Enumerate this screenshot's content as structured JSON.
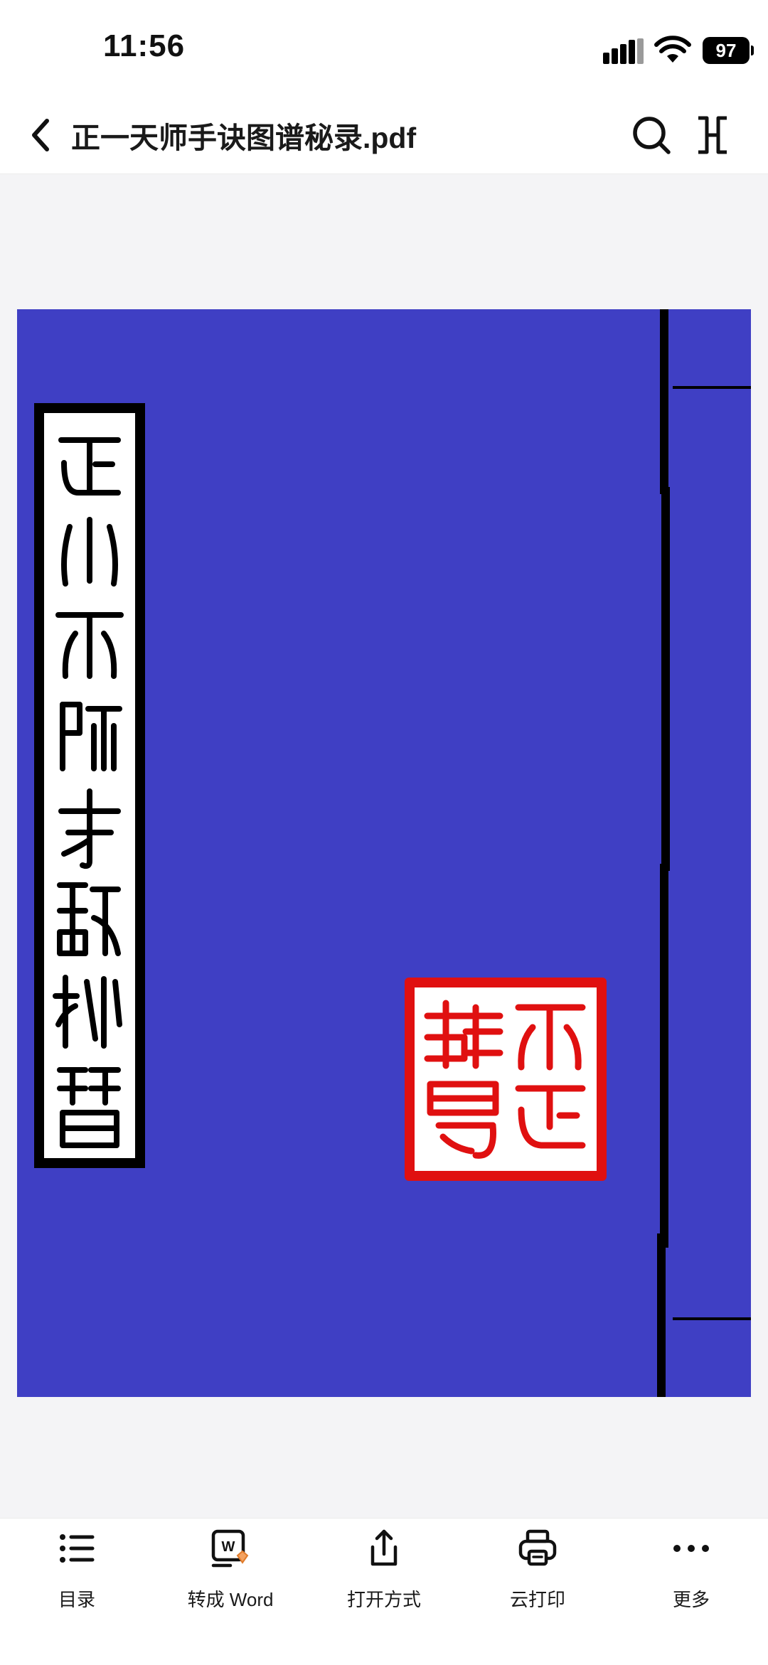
{
  "status_bar": {
    "time": "11:56",
    "battery": "97"
  },
  "header": {
    "title": "正一天师手诀图谱秘录.pdf"
  },
  "icons": {
    "back": "chevron-left-icon",
    "search": "search-icon",
    "expand": "expand-icon",
    "toc": "list-icon",
    "word": "word-convert-icon",
    "open_with": "share-icon",
    "print": "printer-icon",
    "more": "more-dots-icon"
  },
  "document": {
    "cover_color": "#3f3fc4",
    "seal_color": "#e01010",
    "cover_title_text": "正一天师手诀秘谱",
    "seal_text": "天正轉易"
  },
  "toolbar": {
    "items": [
      {
        "label": "目录"
      },
      {
        "label": "转成 Word"
      },
      {
        "label": "打开方式"
      },
      {
        "label": "云打印"
      },
      {
        "label": "更多"
      }
    ]
  }
}
